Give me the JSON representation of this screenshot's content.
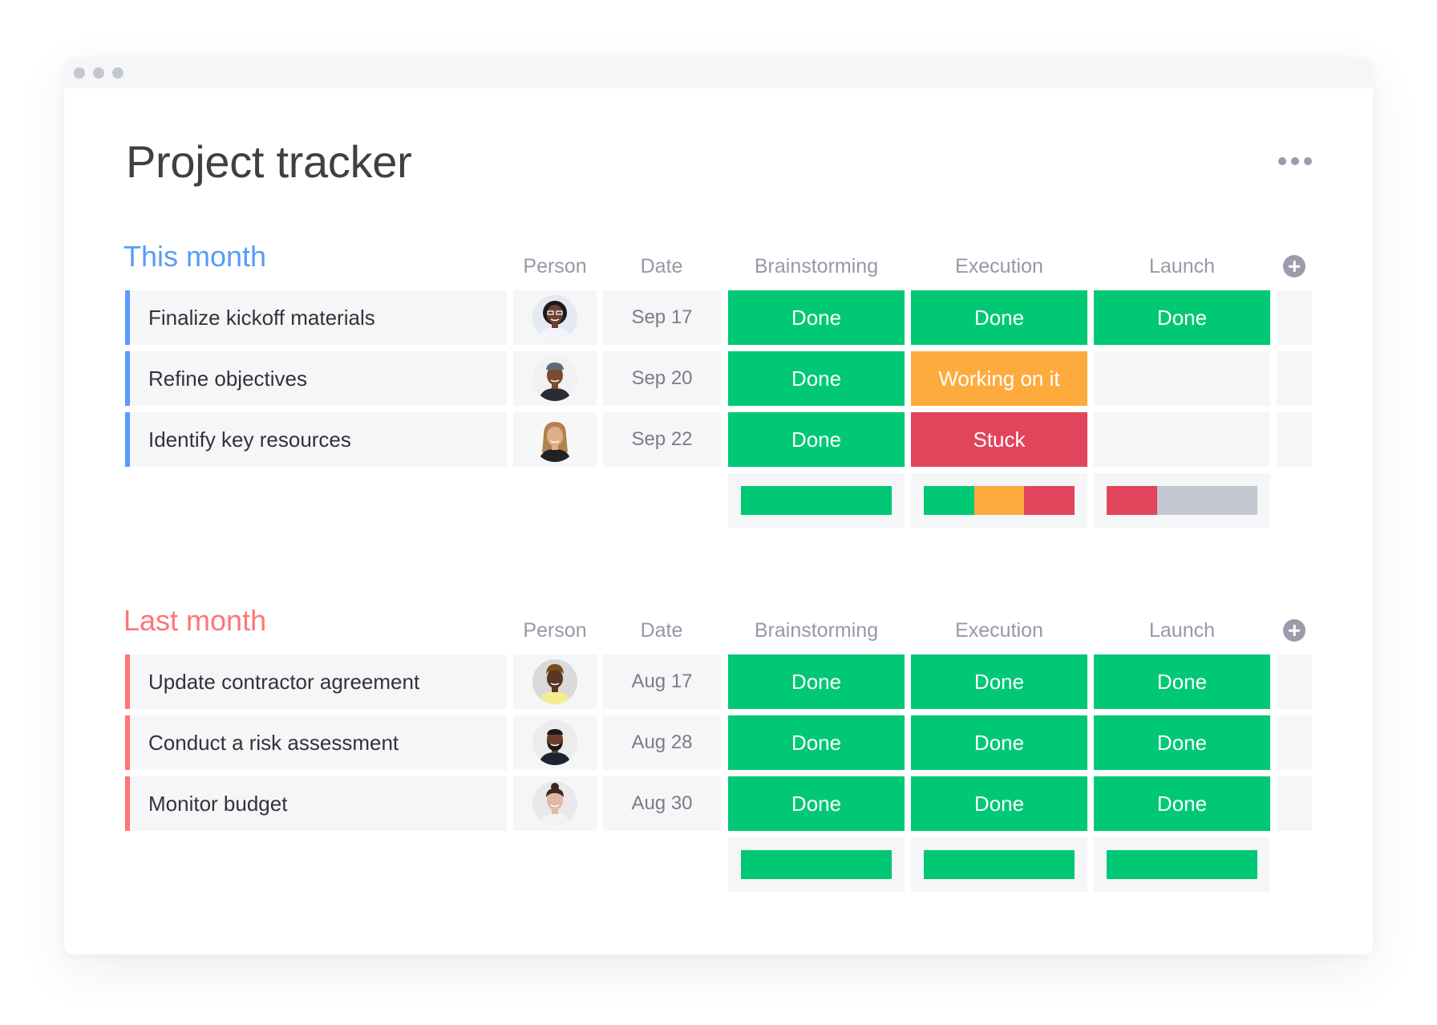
{
  "window": {
    "title": "Project tracker",
    "more_menu": "more-options"
  },
  "colors": {
    "done": "#00c875",
    "working": "#fdab3d",
    "stuck": "#e2445c",
    "empty": "#c4c6d0",
    "this_month": "#579bfc",
    "last_month": "#ff7575"
  },
  "columns": [
    "Person",
    "Date",
    "Brainstorming",
    "Execution",
    "Launch"
  ],
  "groups": [
    {
      "title": "This month",
      "color": "#579bfc",
      "rows": [
        {
          "task": "Finalize kickoff materials",
          "person": "avatar-woman-glasses",
          "date": "Sep 17",
          "brainstorming": "Done",
          "execution": "Done",
          "launch": "Done"
        },
        {
          "task": "Refine objectives",
          "person": "avatar-man-cap",
          "date": "Sep 20",
          "brainstorming": "Done",
          "execution": "Working on it",
          "launch": ""
        },
        {
          "task": "Identify key resources",
          "person": "avatar-woman-blonde",
          "date": "Sep 22",
          "brainstorming": "Done",
          "execution": "Stuck",
          "launch": ""
        }
      ],
      "summary": {
        "brainstorming": [
          {
            "status": "done",
            "fraction": 1.0
          }
        ],
        "execution": [
          {
            "status": "done",
            "fraction": 0.333
          },
          {
            "status": "working",
            "fraction": 0.333
          },
          {
            "status": "stuck",
            "fraction": 0.334
          }
        ],
        "launch": [
          {
            "status": "stuck",
            "fraction": 0.333
          },
          {
            "status": "empty",
            "fraction": 0.667
          }
        ]
      }
    },
    {
      "title": "Last month",
      "color": "#ff7575",
      "rows": [
        {
          "task": "Update contractor agreement",
          "person": "avatar-man-yellow-shirt",
          "date": "Aug 17",
          "brainstorming": "Done",
          "execution": "Done",
          "launch": "Done"
        },
        {
          "task": "Conduct a risk assessment",
          "person": "avatar-man-beard",
          "date": "Aug 28",
          "brainstorming": "Done",
          "execution": "Done",
          "launch": "Done"
        },
        {
          "task": "Monitor budget",
          "person": "avatar-woman-brunette",
          "date": "Aug 30",
          "brainstorming": "Done",
          "execution": "Done",
          "launch": "Done"
        }
      ],
      "summary": {
        "brainstorming": [
          {
            "status": "done",
            "fraction": 1.0
          }
        ],
        "execution": [
          {
            "status": "done",
            "fraction": 1.0
          }
        ],
        "launch": [
          {
            "status": "done",
            "fraction": 1.0
          }
        ]
      }
    }
  ]
}
